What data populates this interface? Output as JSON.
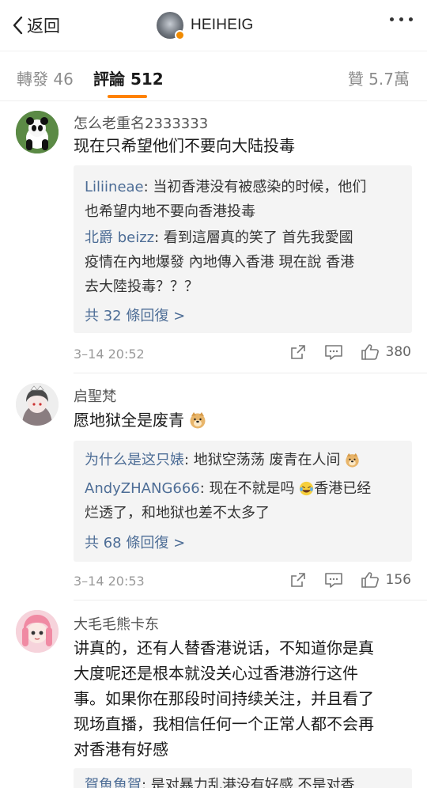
{
  "nav": {
    "back_label": "返回",
    "author_name": "HEIHEIG",
    "badge_color": "#f08a00"
  },
  "tabs": {
    "repost": "轉發 46",
    "comments": "評論 512",
    "likes": "贊 5.7萬"
  },
  "accent": "#ff8200",
  "link_color": "#4d6d96",
  "comments": [
    {
      "username": "怎么老重名2333333",
      "lines": [
        "现在只希望他们不要向大陆投毒"
      ],
      "replies": [
        {
          "user": "Liliineae",
          "lines": [
            "当初香港没有被感染的时候，他们",
            "也希望内地不要向香港投毒"
          ]
        },
        {
          "user": "北爵 beizz",
          "lines": [
            "看到這層真的笑了 首先我愛國",
            "疫情在內地爆發 內地傳入香港 現在說 香港",
            "去大陸投毒？？？"
          ]
        }
      ],
      "replies_more": "共 32 條回復 >",
      "time": "3–14 20:52",
      "likes": "380"
    },
    {
      "username": "启聖梵",
      "lines": [
        "愿地狱全是废青"
      ],
      "replies": [
        {
          "user": "为什么是这只婊",
          "lines": [
            "地狱空荡荡 废青在人间"
          ]
        },
        {
          "user": "AndyZHANG666",
          "lines": [
            "现在不就是吗",
            "香港已经",
            "烂透了，和地狱也差不太多了"
          ]
        }
      ],
      "replies_more": "共 68 條回復 >",
      "time": "3–14 20:53",
      "likes": "156"
    },
    {
      "username": "大毛毛熊卡东",
      "lines": [
        "讲真的，还有人替香港说话，不知道你是真",
        "大度呢还是根本就没关心过香港游行这件",
        "事。如果你在那段时间持续关注，并且看了",
        "现场直播，我相信任何一个正常人都不会再",
        "对香港有好感"
      ],
      "replies": [
        {
          "user": "賀魚魚賀",
          "lines": [
            "是对暴力乱港没有好感 不是对香"
          ]
        }
      ]
    }
  ]
}
